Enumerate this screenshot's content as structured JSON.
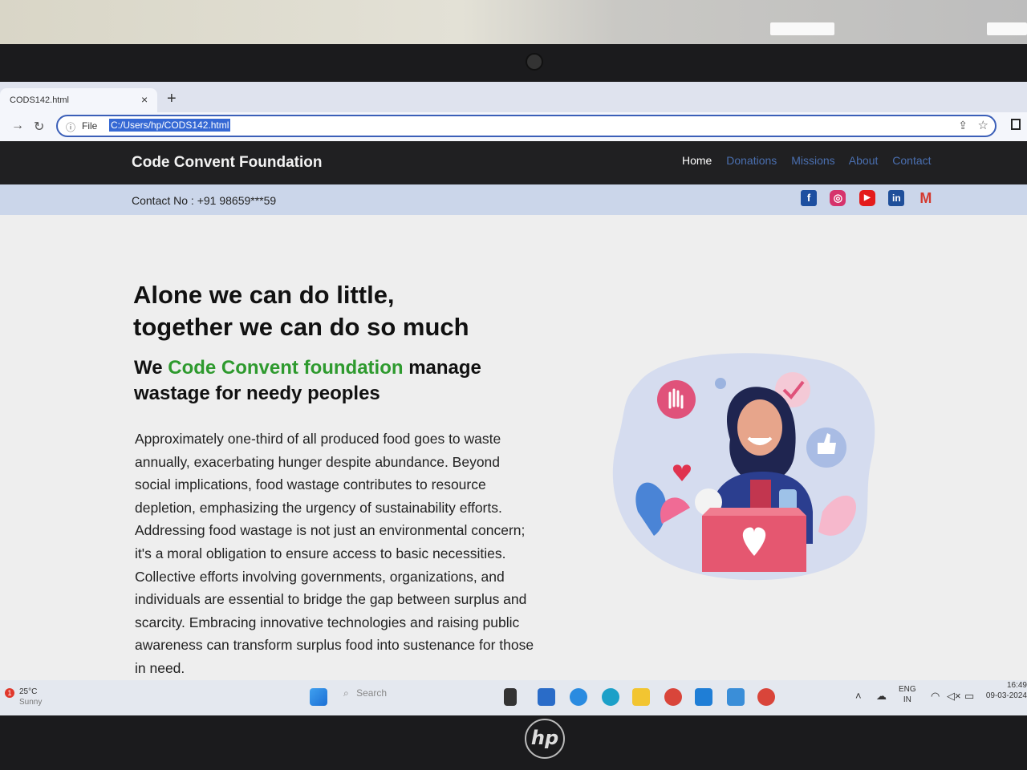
{
  "browser": {
    "tab_title": "CODS142.html",
    "tab_close": "×",
    "new_tab": "+",
    "file_label": "File",
    "url": "C:/Users/hp/CODS142.html"
  },
  "site": {
    "brand": "Code Convent Foundation",
    "nav": [
      "Home",
      "Donations",
      "Missions",
      "About",
      "Contact"
    ],
    "contact": "Contact No : +91 98659***59",
    "social_icons": [
      "facebook-icon",
      "instagram-icon",
      "youtube-icon",
      "linkedin-icon",
      "gmail-icon"
    ],
    "headline_line1": "Alone we can do little,",
    "headline_line2": "together we can do so much",
    "sub_before": "We ",
    "sub_highlight": "Code Convent foundation",
    "sub_after": " manage wastage for needy peoples",
    "paragraph": "Approximately one-third of all produced food goes to waste annually, exacerbating hunger despite abundance. Beyond social implications, food wastage contributes to resource depletion, emphasizing the urgency of sustainability efforts. Addressing food wastage is not just an environmental concern; it's a moral obligation to ensure access to basic necessities. Collective efforts involving governments, organizations, and individuals are essential to bridge the gap between surplus and scarcity. Embracing innovative technologies and raising public awareness can transform surplus food into sustenance for those in need.",
    "colors": {
      "highlight": "#2e9a2e",
      "header_bg": "#202022",
      "contact_bar": "#cbd6ea"
    }
  },
  "taskbar": {
    "weather_badge": "1",
    "temperature": "25°C",
    "condition": "Sunny",
    "search_placeholder": "Search",
    "lang_line1": "ENG",
    "lang_line2": "IN",
    "time": "16:49",
    "date": "09-03-2024"
  }
}
